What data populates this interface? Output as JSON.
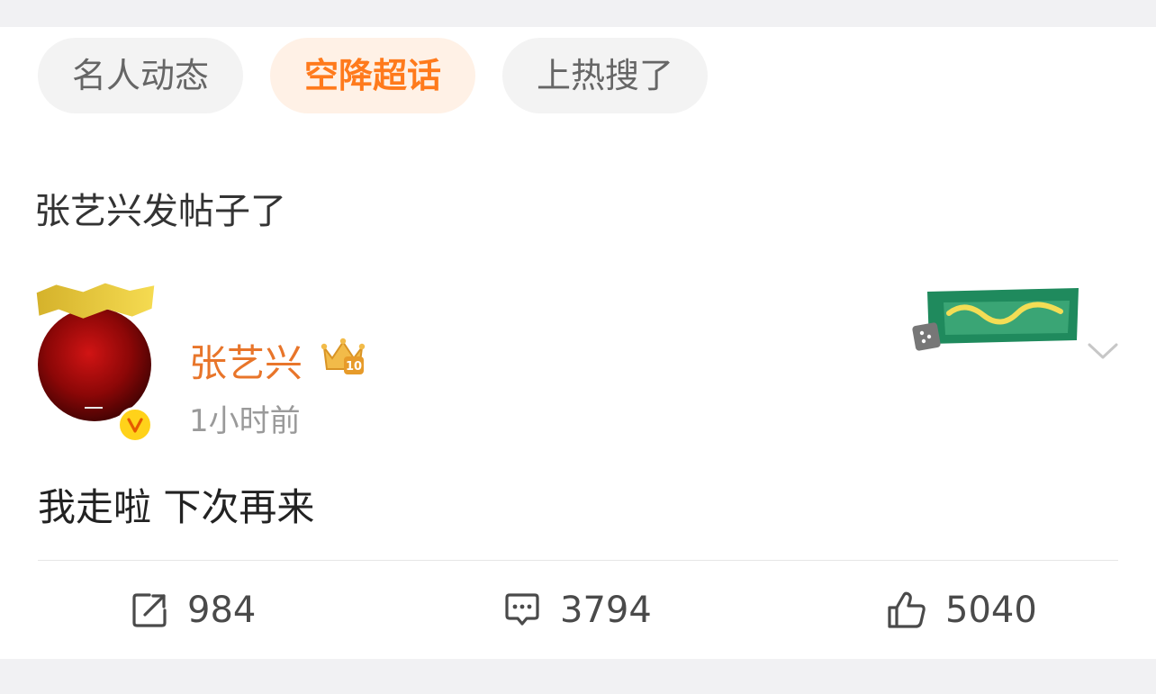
{
  "chips": [
    {
      "label": "名人动态",
      "active": false
    },
    {
      "label": "空降超话",
      "active": true
    },
    {
      "label": "上热搜了",
      "active": false
    }
  ],
  "section_title": "张艺兴发帖子了",
  "post": {
    "author": "张艺兴",
    "level_badge": "10",
    "time": "1小时前",
    "verified_icon": "verified-v-icon",
    "text": "我走啦 下次再来"
  },
  "actions": {
    "repost_count": "984",
    "comment_count": "3794",
    "like_count": "5040"
  },
  "colors": {
    "accent": "#ff7a1c",
    "username": "#e8752a",
    "chip_bg": "#f3f3f3",
    "chip_active_bg": "#fff1e6"
  }
}
